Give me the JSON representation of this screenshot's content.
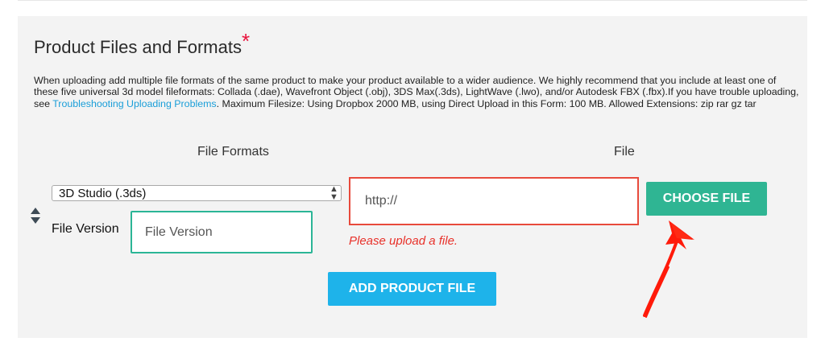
{
  "section": {
    "title": "Product Files and Formats",
    "required_mark": "*",
    "description_before_link": "When uploading add multiple file formats of the same product to make your product available to a wider audience. We highly recommend that you include at least one of these five universal 3d model fileformats: Collada (.dae), Wavefront Object (.obj), 3DS Max(.3ds), LightWave (.lwo), and/or Autodesk FBX (.fbx).If you have trouble uploading, see ",
    "description_link": "Troubleshooting Uploading Problems",
    "description_after_link": ". Maximum Filesize: Using Dropbox 2000 MB, using Direct Upload in this Form: 100 MB. Allowed Extensions: zip rar gz tar"
  },
  "columns": {
    "formats": "File Formats",
    "file": "File"
  },
  "format_select": {
    "selected": "3D Studio (.3ds)",
    "arrows": "⇕"
  },
  "file_version": {
    "label": "File Version",
    "placeholder": "File Version"
  },
  "file_url": {
    "value": "http://"
  },
  "error": {
    "message": "Please upload a file."
  },
  "buttons": {
    "choose_file": "CHOOSE FILE",
    "add_product_file": "ADD PRODUCT FILE"
  },
  "colors": {
    "required": "#e8123c",
    "link": "#1a9ed8",
    "choose_button": "#2fb593",
    "add_button": "#1eb3ea",
    "error": "#e8312a",
    "annotation_arrow": "#ff1a0a"
  },
  "icons": {
    "reorder": "up-down-triangles-icon",
    "select_arrows": "chevron-updown-icon",
    "annotation": "hand-drawn-red-arrow-icon"
  }
}
